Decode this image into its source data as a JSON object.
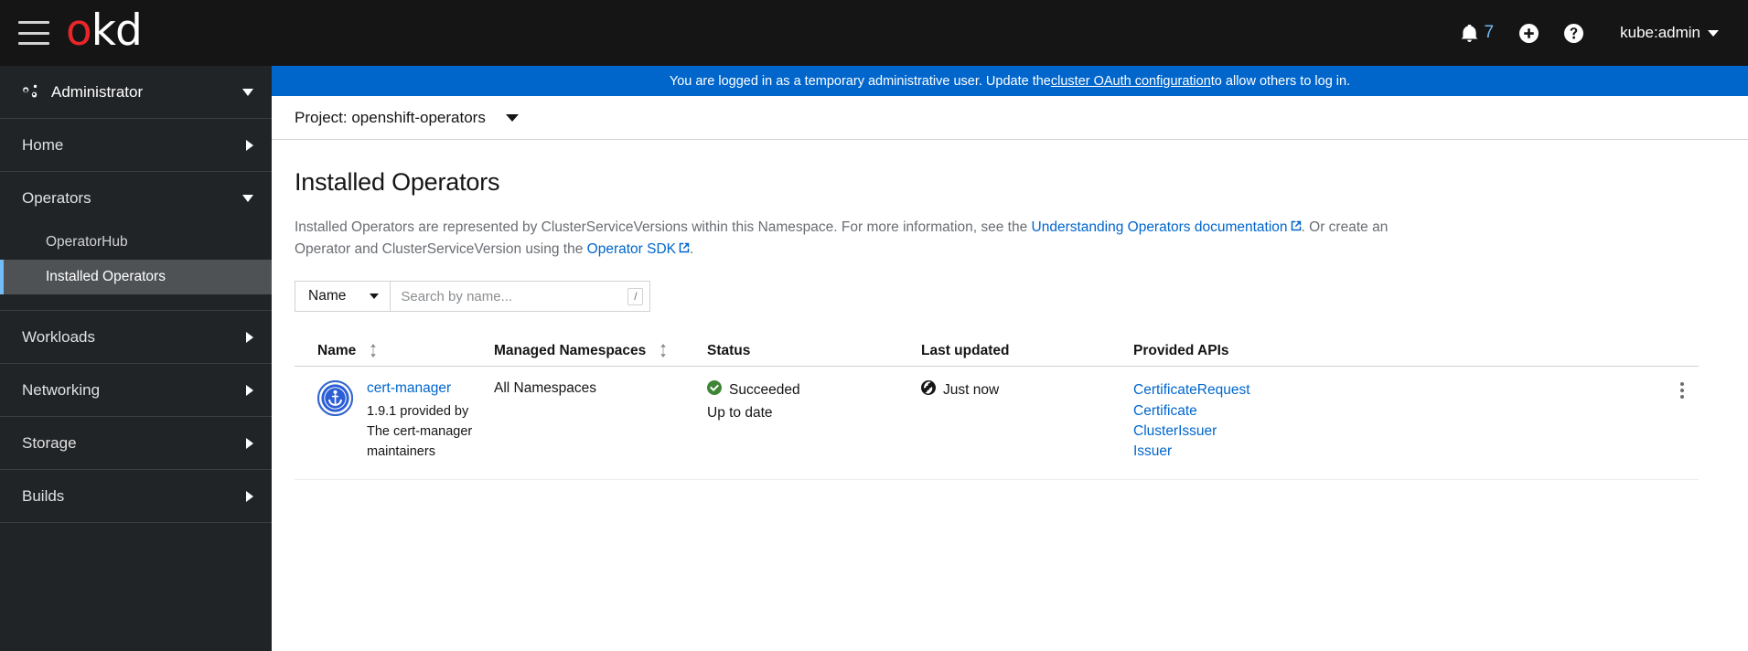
{
  "masthead": {
    "menu_icon": "hamburger-icon",
    "logo_first": "o",
    "logo_rest": "kd",
    "notification_icon": "bell-icon",
    "notification_count": "7",
    "plus_icon": "plus-circle-icon",
    "help_icon": "question-circle-icon",
    "username": "kube:admin"
  },
  "sidebar": {
    "perspective": {
      "icon": "cogs-icon",
      "label": "Administrator"
    },
    "items": [
      {
        "label": "Home",
        "expanded": false
      },
      {
        "label": "Operators",
        "expanded": true
      },
      {
        "label": "Workloads",
        "expanded": false
      },
      {
        "label": "Networking",
        "expanded": false
      },
      {
        "label": "Storage",
        "expanded": false
      },
      {
        "label": "Builds",
        "expanded": false
      }
    ],
    "operators_subitems": [
      {
        "label": "OperatorHub",
        "active": false
      },
      {
        "label": "Installed Operators",
        "active": true
      }
    ]
  },
  "banner": {
    "text_before": "You are logged in as a temporary administrative user. Update the ",
    "link": "cluster OAuth configuration",
    "text_after": " to allow others to log in.",
    "background": "#0066cc"
  },
  "project_bar": {
    "label": "Project: openshift-operators"
  },
  "page": {
    "title": "Installed Operators",
    "desc_part1": "Installed Operators are represented by ClusterServiceVersions within this Namespace. For more information, see the ",
    "desc_link1": "Understanding Operators documentation",
    "desc_part2": ". Or create an Operator and ClusterServiceVersion using the ",
    "desc_link2": "Operator SDK",
    "desc_part3": "."
  },
  "toolbar": {
    "filter_label": "Name",
    "search_placeholder": "Search by name...",
    "search_value": "",
    "shortcut_badge": "/"
  },
  "table": {
    "columns": [
      {
        "label": "Name",
        "sortable": true
      },
      {
        "label": "Managed Namespaces",
        "sortable": true
      },
      {
        "label": "Status",
        "sortable": false
      },
      {
        "label": "Last updated",
        "sortable": false
      },
      {
        "label": "Provided APIs",
        "sortable": false
      }
    ],
    "rows": [
      {
        "logo": "cert-manager-anchor-icon",
        "name": "cert-manager",
        "version": "1.9.1 provided by The cert-manager maintainers",
        "namespaces": "All Namespaces",
        "status": "Succeeded",
        "status_icon": "check-circle-icon",
        "status_sub": "Up to date",
        "last_updated": "Just now",
        "last_updated_icon": "globe-icon",
        "apis": [
          "CertificateRequest",
          "Certificate",
          "ClusterIssuer",
          "Issuer"
        ],
        "actions_icon": "kebab-icon"
      }
    ]
  },
  "colors": {
    "brand_red": "#e8262a",
    "link_blue": "#0066cc",
    "banner_blue": "#0066cc",
    "success_green": "#3e8635",
    "masthead_bg": "#151515",
    "sidebar_bg": "#212427",
    "active_nav_bg": "#4f5255",
    "active_nav_border": "#73bcf7"
  }
}
